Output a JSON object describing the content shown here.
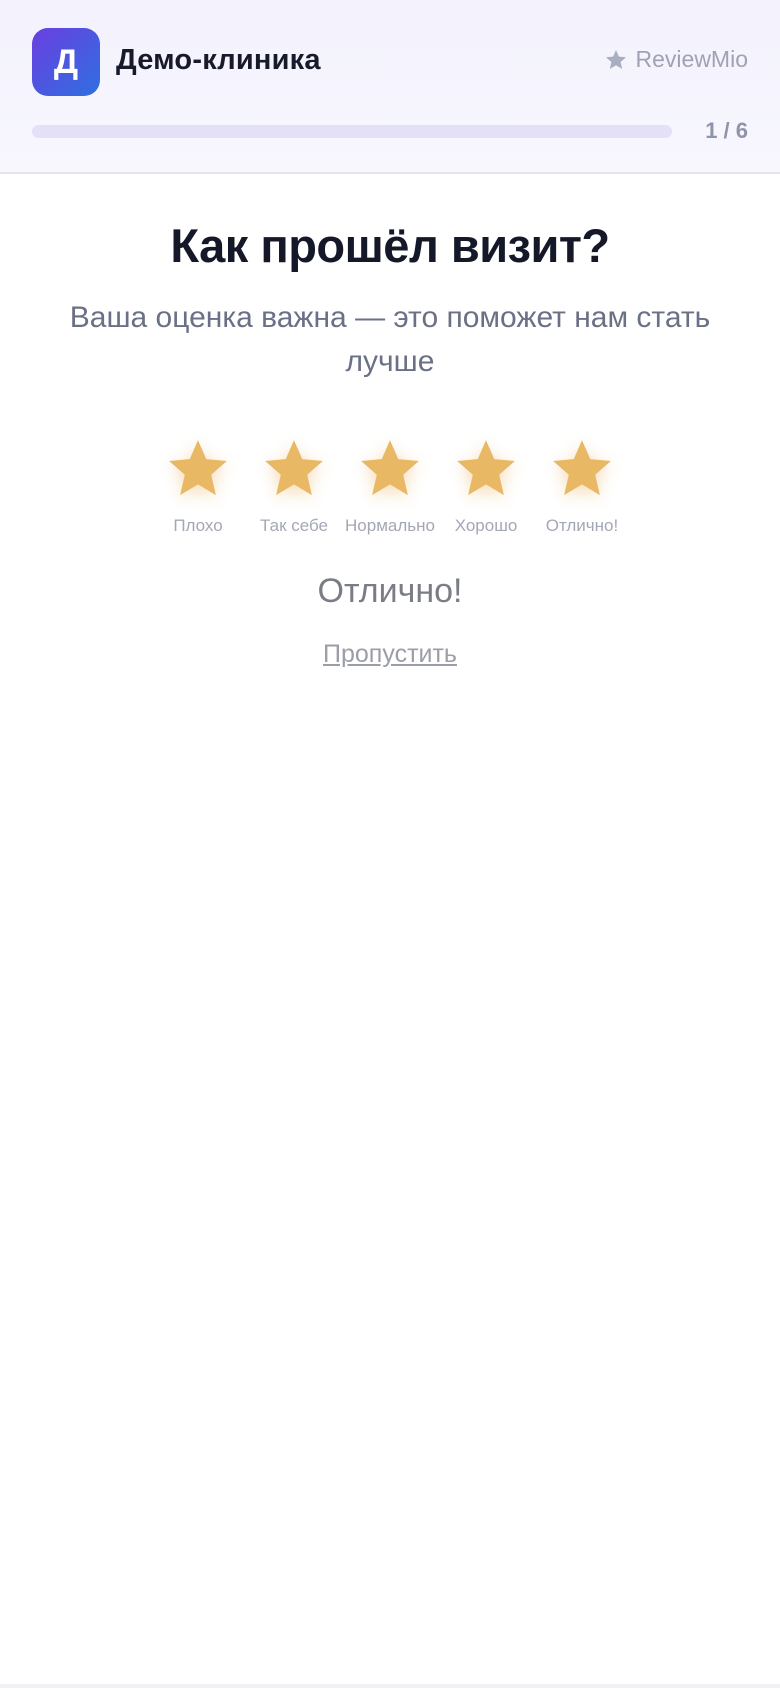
{
  "header": {
    "logo_letter": "Д",
    "clinic_name": "Демо-клиника",
    "brand_icon": "star-icon",
    "brand_name": "ReviewMio",
    "progress": {
      "current": 1,
      "total": 6,
      "label": "1 / 6"
    }
  },
  "question": {
    "title": "Как прошёл визит?",
    "subtitle": "Ваша оценка важна — это поможет нам стать лучше"
  },
  "rating": {
    "selected": 5,
    "star_color": "#e8b864",
    "options": [
      {
        "value": 1,
        "label": "Плохо"
      },
      {
        "value": 2,
        "label": "Так себе"
      },
      {
        "value": 3,
        "label": "Нормально"
      },
      {
        "value": 4,
        "label": "Хорошо"
      },
      {
        "value": 5,
        "label": "Отлично!"
      }
    ],
    "result_text": "Отлично!"
  },
  "actions": {
    "skip_label": "Пропустить"
  },
  "colors": {
    "accent": "#6a55e8",
    "logo_gradient_start": "#6a3fe0",
    "logo_gradient_end": "#2f6fe0"
  }
}
